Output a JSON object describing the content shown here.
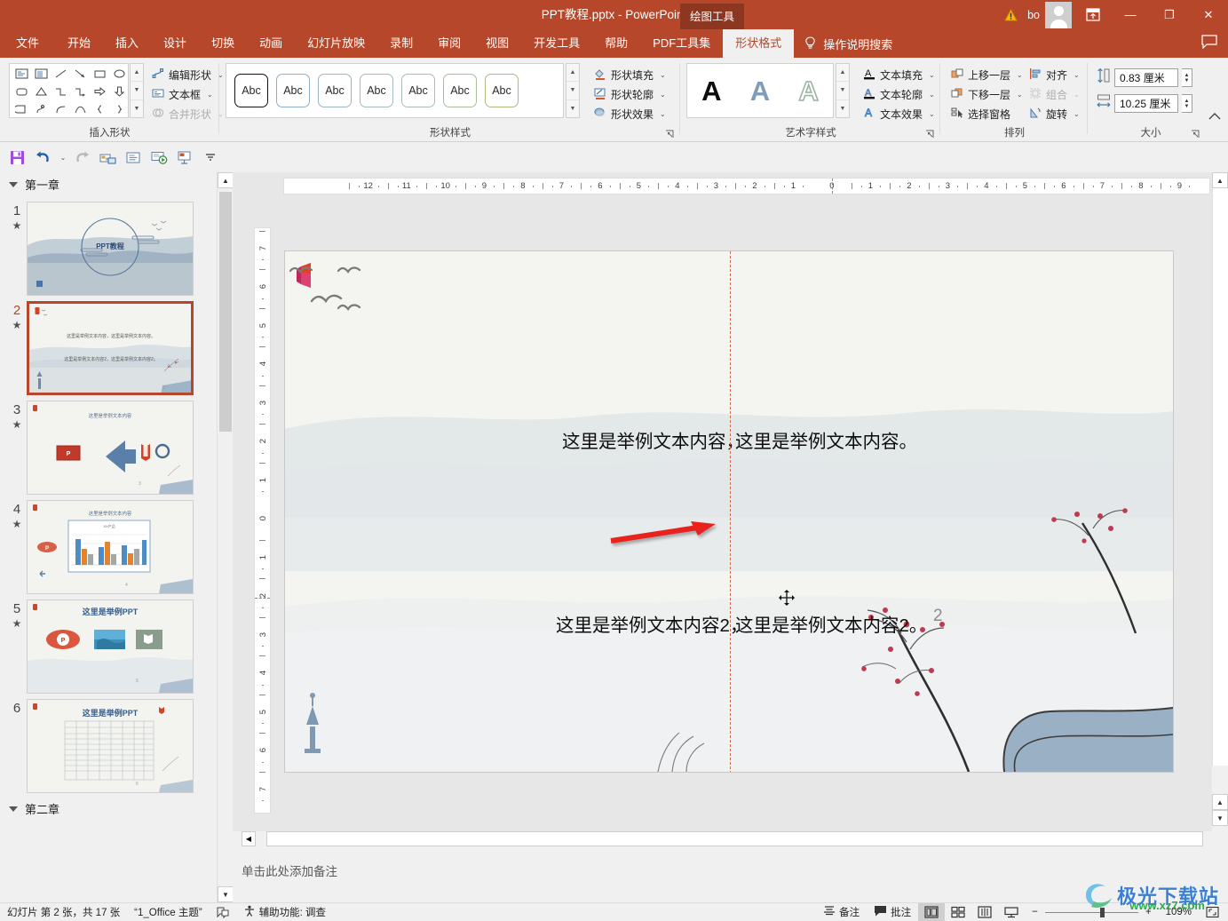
{
  "window": {
    "title": "PPT教程.pptx  -  PowerPoint",
    "contextual_tab_label": "绘图工具",
    "account_name": "bo",
    "warning_icon": "warning-triangle-icon",
    "avatar_icon": "user-avatar-icon",
    "ribbon_display_icon": "ribbon-display-options-icon",
    "minimize_label": "—",
    "maximize_label": "❐",
    "close_label": "✕",
    "feedback_icon": "feedback-comment-icon"
  },
  "tabs": [
    {
      "label": "文件",
      "active": false
    },
    {
      "label": "开始",
      "active": false
    },
    {
      "label": "插入",
      "active": false
    },
    {
      "label": "设计",
      "active": false
    },
    {
      "label": "切换",
      "active": false
    },
    {
      "label": "动画",
      "active": false
    },
    {
      "label": "幻灯片放映",
      "active": false
    },
    {
      "label": "录制",
      "active": false
    },
    {
      "label": "审阅",
      "active": false
    },
    {
      "label": "视图",
      "active": false
    },
    {
      "label": "开发工具",
      "active": false
    },
    {
      "label": "帮助",
      "active": false
    },
    {
      "label": "PDF工具集",
      "active": false
    },
    {
      "label": "形状格式",
      "active": true
    }
  ],
  "tell_me": {
    "label": "操作说明搜索",
    "icon": "lightbulb-icon"
  },
  "ribbon": {
    "groups": [
      {
        "name": "插入形状",
        "buttons": [
          {
            "label": "编辑形状",
            "icon": "edit-shape-icon",
            "disabled": false
          },
          {
            "label": "文本框",
            "icon": "text-box-icon",
            "disabled": false
          },
          {
            "label": "合并形状",
            "icon": "merge-shapes-icon",
            "disabled": true
          }
        ]
      },
      {
        "name": "形状样式",
        "styles": [
          "Abc",
          "Abc",
          "Abc",
          "Abc",
          "Abc",
          "Abc",
          "Abc"
        ],
        "selected_style_index": 0,
        "buttons": [
          {
            "label": "形状填充",
            "icon": "shape-fill-icon"
          },
          {
            "label": "形状轮廓",
            "icon": "shape-outline-icon"
          },
          {
            "label": "形状效果",
            "icon": "shape-effects-icon"
          }
        ]
      },
      {
        "name": "艺术字样式",
        "wordart": [
          "A",
          "A",
          "A"
        ],
        "buttons": [
          {
            "label": "文本填充",
            "icon": "text-fill-icon"
          },
          {
            "label": "文本轮廓",
            "icon": "text-outline-icon"
          },
          {
            "label": "文本效果",
            "icon": "text-effects-icon"
          }
        ]
      },
      {
        "name": "排列",
        "buttons": [
          {
            "label": "上移一层",
            "icon": "bring-forward-icon",
            "disabled": false
          },
          {
            "label": "对齐",
            "icon": "align-icon",
            "disabled": false
          },
          {
            "label": "下移一层",
            "icon": "send-backward-icon",
            "disabled": false
          },
          {
            "label": "组合",
            "icon": "group-icon",
            "disabled": true
          },
          {
            "label": "选择窗格",
            "icon": "selection-pane-icon",
            "disabled": false
          },
          {
            "label": "旋转",
            "icon": "rotate-icon",
            "disabled": false
          }
        ]
      },
      {
        "name": "大小",
        "height": {
          "icon": "shape-height-icon",
          "value": "0.83 厘米"
        },
        "width": {
          "icon": "shape-width-icon",
          "value": "10.25 厘米"
        }
      }
    ],
    "collapse_icon": "collapse-ribbon-icon"
  },
  "quick_access": [
    {
      "name": "save-icon",
      "glyph": "save"
    },
    {
      "name": "undo-icon",
      "glyph": "undo"
    },
    {
      "name": "undo-dropdown-icon",
      "glyph": "caret"
    },
    {
      "name": "redo-icon",
      "glyph": "redo"
    },
    {
      "name": "start-from-beginning-icon",
      "glyph": "present"
    },
    {
      "name": "new-slide-icon",
      "glyph": "newslide"
    },
    {
      "name": "slideshow-icon",
      "glyph": "slideshow"
    },
    {
      "name": "from-current-slide-icon",
      "glyph": "current"
    },
    {
      "name": "customize-qat-icon",
      "glyph": "more"
    }
  ],
  "thumbnail_pane": {
    "sections": [
      {
        "label": "第一章",
        "position": "top"
      },
      {
        "label": "第二章",
        "position": "bottom"
      }
    ],
    "slides": [
      {
        "number": "1",
        "starred": true,
        "selected": false,
        "kind": "cover",
        "title": "PPT教程"
      },
      {
        "number": "2",
        "starred": true,
        "selected": true,
        "kind": "two-text",
        "line1": "这里是举例文本内容，这里是举例文本内容。",
        "line2": "这里是举例文本内容2，这里是举例文本内容2。",
        "page": "2"
      },
      {
        "number": "3",
        "starred": true,
        "selected": false,
        "kind": "icons",
        "title": "这里是举例文本内容",
        "page": "3"
      },
      {
        "number": "4",
        "starred": true,
        "selected": false,
        "kind": "chart",
        "title": "这里是举例文本内容",
        "chart_title": "XX产品",
        "page": "4"
      },
      {
        "number": "5",
        "starred": true,
        "selected": false,
        "kind": "images",
        "title": "这里是举例PPT",
        "page": "5"
      },
      {
        "number": "6",
        "starred": false,
        "selected": false,
        "kind": "table",
        "title": "这里是举例PPT",
        "page": "6"
      }
    ]
  },
  "ruler": {
    "horizontal_left": [
      "12",
      "11",
      "10",
      "9",
      "8",
      "7",
      "6",
      "5",
      "4",
      "3",
      "2",
      "1"
    ],
    "horizontal_right": [
      "1",
      "2",
      "3",
      "4",
      "5",
      "6",
      "7",
      "8",
      "9",
      "10",
      "11",
      "12"
    ],
    "horizontal_center": "0",
    "vertical_top": [
      "7",
      "6",
      "5",
      "4",
      "3",
      "2",
      "1"
    ],
    "vertical_center": "0",
    "vertical_bottom": [
      "1",
      "2",
      "3",
      "4",
      "5",
      "6",
      "7"
    ],
    "unit": "厘米"
  },
  "slide": {
    "text_line_1_left": "这里是举例文本内容，",
    "text_line_1_right": "这里是举例文本内容。",
    "text_line_2_left": "这里是举例文本内容2，",
    "text_line_2_right": "这里是举例文本内容2。",
    "page_number": "2",
    "annotation_arrow": "red-arrow-annotation",
    "smart_guide": "vertical-dashed-alignment-guide",
    "move_cursor": "move-cursor-icon",
    "office_logo": "office-logo-icon",
    "birds": "flying-birds-decoration",
    "statue": "statue-of-liberty-decoration",
    "branch": "plum-blossom-branch-decoration"
  },
  "notes": {
    "placeholder": "单击此处添加备注"
  },
  "status_bar": {
    "slide_count": "幻灯片 第 2 张，共 17 张",
    "theme": "“1_Office 主题”",
    "language_icon": "language-icon",
    "accessibility": "辅助功能: 调查",
    "accessibility_icon": "accessibility-icon",
    "notes_button": "备注",
    "notes_icon": "notes-icon",
    "comments_button": "批注",
    "comments_icon": "comment-icon",
    "views": [
      {
        "name": "normal-view-button",
        "icon": "normal-view-icon",
        "active": true
      },
      {
        "name": "slide-sorter-button",
        "icon": "slide-sorter-icon",
        "active": false
      },
      {
        "name": "reading-view-button",
        "icon": "reading-view-icon",
        "active": false
      },
      {
        "name": "slideshow-button",
        "icon": "slideshow-view-icon",
        "active": false
      }
    ],
    "zoom_out": "−",
    "zoom_in": "+",
    "zoom_level": "109%",
    "fit_slide_icon": "fit-slide-to-window-icon"
  },
  "watermark": {
    "text": "极光下载站",
    "url": "www.xz7.com"
  },
  "colors": {
    "brand": "#b7472a",
    "contextual_tab": "#8d3620",
    "ribbon_bg": "#f0f0f0",
    "editor_bg": "#e7e7e7",
    "slide_bg": "#f4f5f0",
    "guide": "#d06a4a",
    "arrow": "#e8201c",
    "accent_blue": "#3a7fd5"
  }
}
